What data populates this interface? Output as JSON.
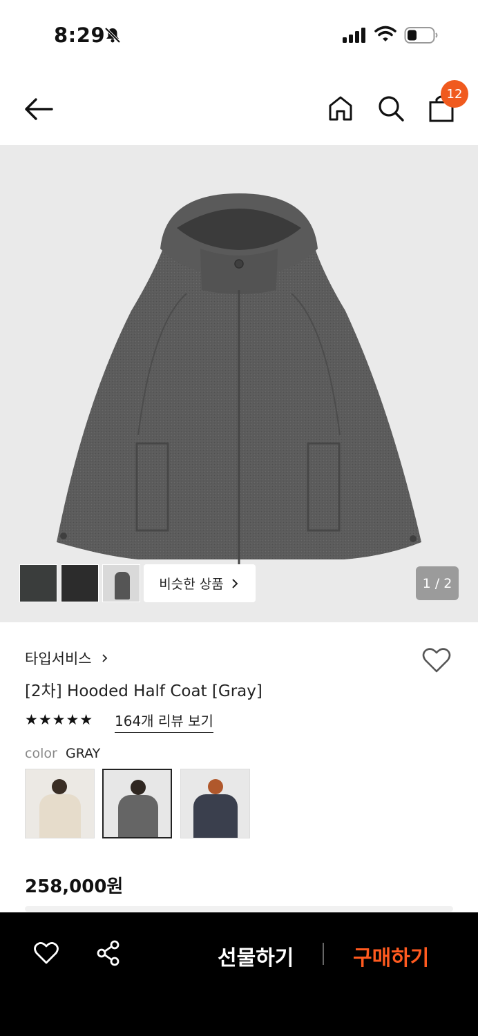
{
  "status_bar": {
    "time": "8:29"
  },
  "header": {
    "cart_count": "12"
  },
  "gallery": {
    "similar_label": "비슷한 상품",
    "pager": "1 / 2"
  },
  "product": {
    "brand": "타입서비스",
    "title": "[2차] Hooded Half Coat [Gray]",
    "rating_stars": "★★★★★",
    "review_link": "164개 리뷰 보기",
    "color_label": "color",
    "color_value": "GRAY",
    "price": "258,000원"
  },
  "bottom_bar": {
    "gift_label": "선물하기",
    "buy_label": "구매하기"
  },
  "colors": {
    "accent": "#f05a1e",
    "buy": "#ff5a1f",
    "coat": "#5b5b5b",
    "bg_image": "#eaeaea"
  }
}
